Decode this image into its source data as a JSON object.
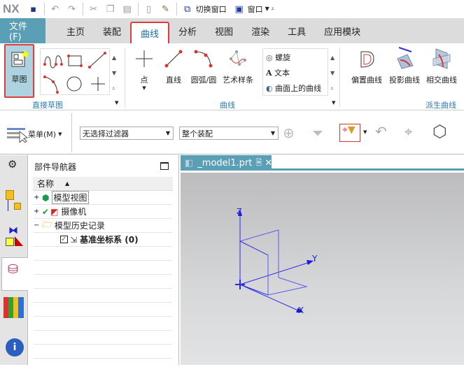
{
  "app": {
    "logo": "NX"
  },
  "quick_access": {
    "switch_window": "切换窗口",
    "window": "窗口"
  },
  "tabs": [
    {
      "label": "文件(F)"
    },
    {
      "label": "主页"
    },
    {
      "label": "装配"
    },
    {
      "label": "曲线"
    },
    {
      "label": "分析"
    },
    {
      "label": "视图"
    },
    {
      "label": "渲染"
    },
    {
      "label": "工具"
    },
    {
      "label": "应用模块"
    }
  ],
  "ribbon": {
    "sketch": "草图",
    "group_direct_sketch": "直接草图",
    "point": "点",
    "line": "直线",
    "arc": "圆弧/圆",
    "studio_spline": "艺术样条",
    "helix": "螺旋",
    "text": "文本",
    "curve_on_surface": "曲面上的曲线",
    "group_curve": "曲线",
    "offset_curve": "偏置曲线",
    "project_curve": "投影曲线",
    "intersect_curve": "相交曲线",
    "group_derived": "派生曲线"
  },
  "toolbar": {
    "menu": "菜单(M)",
    "filter": "无选择过滤器",
    "scope": "整个装配"
  },
  "navigator": {
    "title": "部件导航器",
    "column": "名称",
    "items": [
      {
        "label": "模型视图",
        "expander": "+"
      },
      {
        "label": "摄像机",
        "expander": "+"
      },
      {
        "label": "模型历史记录",
        "expander": "−"
      },
      {
        "label": "基准坐标系 (0)"
      }
    ]
  },
  "viewport": {
    "tab": "_model1.prt",
    "axes": {
      "x": "X",
      "y": "Y",
      "z": "Z"
    }
  },
  "colors": {
    "accent": "#5a9fb5",
    "highlight": "#e03c3c",
    "axis": "#1a1adc"
  }
}
